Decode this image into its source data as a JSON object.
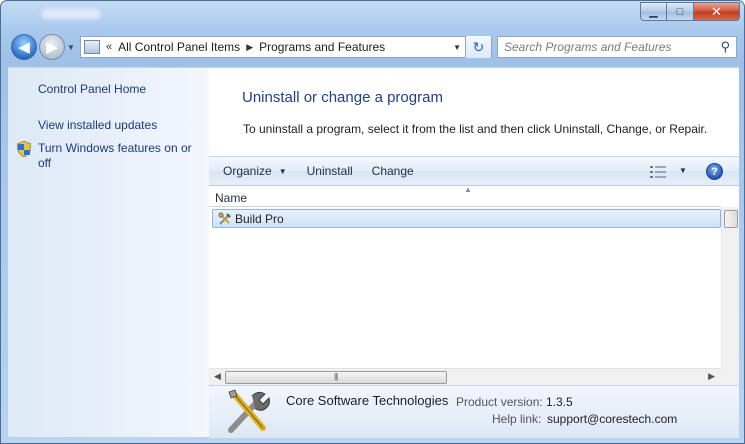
{
  "window": {
    "controls": {
      "minimize": "▁",
      "maximize": "□",
      "close": "✕"
    }
  },
  "nav": {
    "back_glyph": "◀",
    "forward_glyph": "▶",
    "breadcrumb": [
      "All Control Panel Items",
      "Programs and Features"
    ],
    "overflow_glyph": "«",
    "refresh_glyph": "↻"
  },
  "search": {
    "placeholder": "Search Programs and Features"
  },
  "sidebar": {
    "home": "Control Panel Home",
    "updates": "View installed updates",
    "features": "Turn Windows features on or off"
  },
  "main": {
    "title": "Uninstall or change a program",
    "description": "To uninstall a program, select it from the list and then click Uninstall, Change, or Repair."
  },
  "toolbar": {
    "organize": "Organize",
    "uninstall": "Uninstall",
    "change": "Change",
    "help": "?"
  },
  "list": {
    "columns": [
      "Name"
    ],
    "rows": [
      {
        "name": "Build Pro",
        "selected": true
      }
    ]
  },
  "details": {
    "publisher": "Core Software Technologies",
    "product_version_label": "Product version:",
    "product_version": "1.3.5",
    "help_link_label": "Help link:",
    "help_link": "support@corestech.com"
  },
  "colors": {
    "accent_link": "#1e3a78",
    "title_blue": "#1e3f91",
    "selection": "#cfe1f6",
    "close_red": "#c23a1d"
  }
}
